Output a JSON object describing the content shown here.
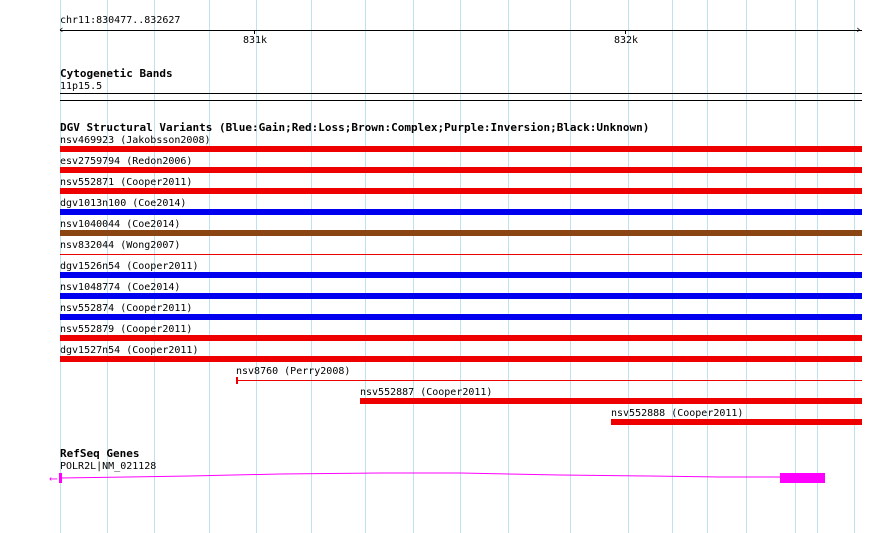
{
  "ruler": {
    "location": "chr11:830477..832627",
    "tick_labels": [
      "831k",
      "832k"
    ]
  },
  "cytoband": {
    "title": "Cytogenetic Bands",
    "band": "11p15.5"
  },
  "dgv": {
    "title": "DGV Structural Variants (Blue:Gain;Red:Loss;Brown:Complex;Purple:Inversion;Black:Unknown)",
    "colors": {
      "gain": "#0000ee",
      "loss": "#ee0000",
      "complex": "#8b4513",
      "inversion": "#800080",
      "unknown": "#000000"
    },
    "variants": [
      {
        "label": "nsv469923 (Jakobsson2008)",
        "type": "loss"
      },
      {
        "label": "esv2759794 (Redon2006)",
        "type": "loss"
      },
      {
        "label": "nsv552871 (Cooper2011)",
        "type": "loss"
      },
      {
        "label": "dgv1013n100 (Coe2014)",
        "type": "gain"
      },
      {
        "label": "nsv1040044 (Coe2014)",
        "type": "complex"
      },
      {
        "label": "nsv832044 (Wong2007)",
        "type": "loss"
      },
      {
        "label": "dgv1526n54 (Cooper2011)",
        "type": "gain"
      },
      {
        "label": "nsv1048774 (Coe2014)",
        "type": "gain"
      },
      {
        "label": "nsv552874 (Cooper2011)",
        "type": "gain"
      },
      {
        "label": "nsv552879 (Cooper2011)",
        "type": "loss"
      },
      {
        "label": "dgv1527n54 (Cooper2011)",
        "type": "loss"
      },
      {
        "label": "nsv8760 (Perry2008)",
        "type": "loss"
      },
      {
        "label": "nsv552887 (Cooper2011)",
        "type": "loss"
      },
      {
        "label": "nsv552888 (Cooper2011)",
        "type": "loss"
      }
    ]
  },
  "refseq": {
    "title": "RefSeq Genes",
    "gene": "POLR2L|NM_021128",
    "strand_icon": "left-arrow-icon",
    "color": "#ff00ff"
  }
}
